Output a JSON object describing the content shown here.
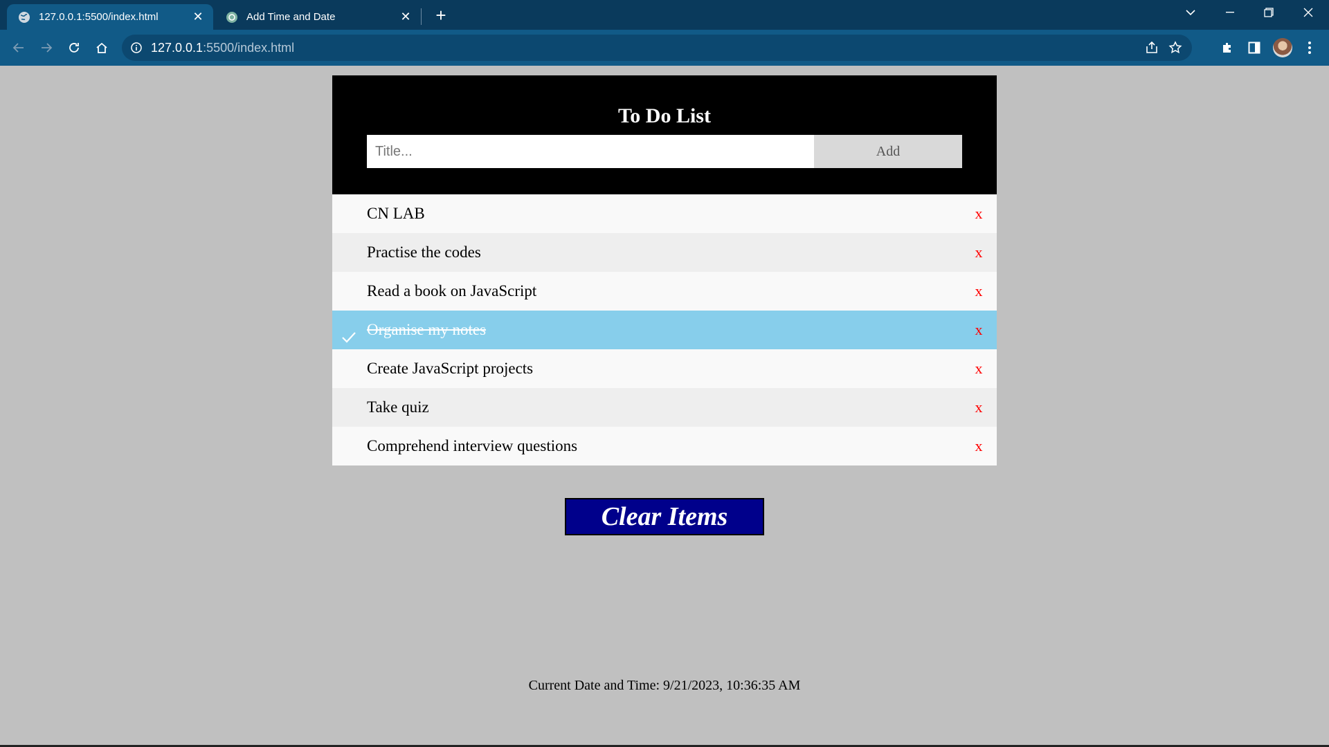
{
  "browser": {
    "tabs": [
      {
        "title": "127.0.0.1:5500/index.html",
        "active": true
      },
      {
        "title": "Add Time and Date",
        "active": false
      }
    ],
    "url_host": "127.0.0.1",
    "url_path": ":5500/index.html"
  },
  "app": {
    "heading": "To Do List",
    "input_placeholder": "Title...",
    "add_label": "Add",
    "items": [
      {
        "text": "CN LAB",
        "checked": false
      },
      {
        "text": "Practise the codes",
        "checked": false
      },
      {
        "text": "Read a book on JavaScript",
        "checked": false
      },
      {
        "text": "Organise my notes",
        "checked": true
      },
      {
        "text": "Create JavaScript projects",
        "checked": false
      },
      {
        "text": "Take quiz",
        "checked": false
      },
      {
        "text": "Comprehend interview questions",
        "checked": false
      }
    ],
    "close_symbol": "x",
    "clear_label": "Clear Items",
    "datetime": "Current Date and Time: 9/21/2023, 10:36:35 AM"
  },
  "colors": {
    "page_bg": "#c0c0c0",
    "header_bg": "#000000",
    "checked_bg": "#87ceeb",
    "close_color": "#ff0000",
    "clear_bg": "#00008b"
  }
}
